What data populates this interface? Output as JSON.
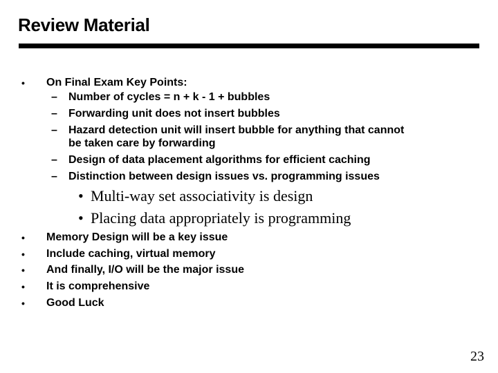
{
  "slide": {
    "title": "Review Material",
    "page_number": "23",
    "bullet_glyph": "•",
    "dash_glyph": "–"
  },
  "main_point": {
    "label": "On Final Exam Key Points:",
    "sub_points": [
      "Number of cycles = n + k - 1 + bubbles",
      "Forwarding unit does not insert bubbles",
      "Hazard detection unit will insert bubble for anything that cannot",
      "Design of data placement algorithms for efficient caching",
      "Distinction between design issues vs. programming issues"
    ],
    "sub_point_3_continuation": "be taken care by forwarding",
    "nested_points": [
      "Multi-way set associativity is design",
      "Placing data appropriately is programming"
    ]
  },
  "closing_points": [
    "Memory Design will be a key issue",
    "Include caching, virtual memory",
    "And finally, I/O will be the major issue",
    "It is comprehensive",
    "Good Luck"
  ]
}
